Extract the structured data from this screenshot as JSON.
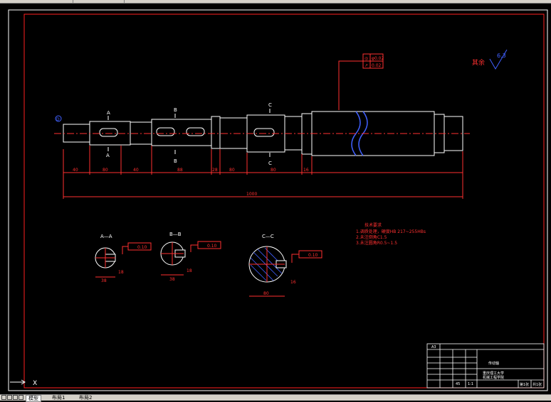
{
  "roughness_label": "其余",
  "roughness_value": "6.3",
  "sections": {
    "a_top": "A",
    "a_bottom": "A",
    "b_top": "B",
    "b_bottom": "B",
    "c_top": "C",
    "c_bottom": "C",
    "aa": "A—A",
    "bb": "B—B",
    "cc": "C—C"
  },
  "datum": "D",
  "tolerance_frame": {
    "sym1": "◎",
    "val1": "φ0.02",
    "sym2": "↗",
    "val2": "0.02"
  },
  "dims": {
    "d1": "40",
    "d2": "80",
    "d3": "40",
    "d4": "88",
    "d5": "28",
    "d6": "80",
    "d7": "80",
    "d8": "16",
    "d9": "16",
    "overall": "1000",
    "aa_width": "38",
    "bb_width": "38",
    "cc_width": "80",
    "key_a": "18",
    "key_b": "18",
    "key_c": "16"
  },
  "section_tol": {
    "aa": "0.10",
    "bb": "0.10",
    "cc": "0.10"
  },
  "tech_req": {
    "title": "技术要求",
    "lines": [
      "1.调质处理，硬度HB 217~255HBs",
      "2.未注倒角C1.5",
      "3.未注圆角R0.5~1.5"
    ]
  },
  "title_block": {
    "sheet_size": "A3",
    "part_name": "传动轴",
    "material": "45",
    "scale": "1:1",
    "sheet": "第1张",
    "total": "共1张",
    "school": "重庆理工大学",
    "dept": "机械工程学院"
  },
  "tabs": [
    "模型",
    "布局1",
    "布局2"
  ],
  "cmd_glyph": "X"
}
